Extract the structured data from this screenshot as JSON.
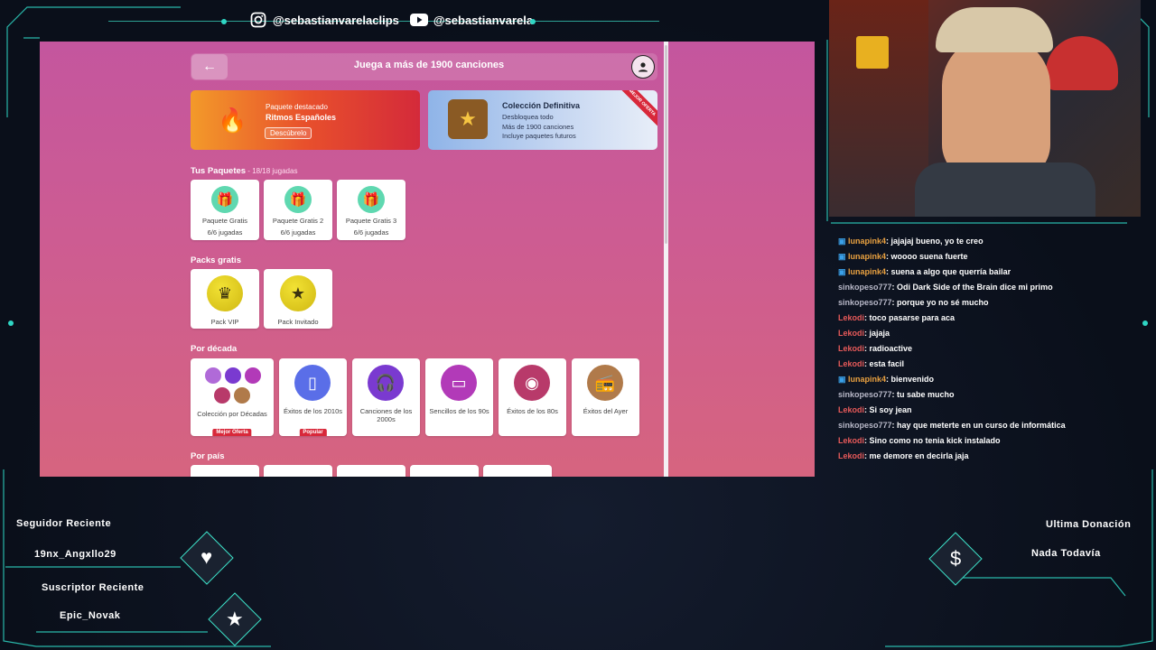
{
  "stream": {
    "instagram_handle": "@sebastianvarelaclips",
    "youtube_handle": "@sebastianvarela",
    "colors": {
      "accent": "#3de0c8",
      "frame_bg": "#0b1220"
    }
  },
  "game": {
    "title": "Juega a más de 1900 canciones",
    "banner_featured": {
      "label": "Paquete destacado",
      "name": "Ritmos Españoles",
      "button": "Descúbrelo"
    },
    "banner_collection": {
      "title": "Colección Definitiva",
      "lines": [
        "Desbloquea todo",
        "Más de 1900 canciones",
        "Incluye paquetes futuros"
      ],
      "ribbon": "MEJOR OFERTA"
    },
    "your_packs": {
      "title": "Tus Paquetes",
      "count": " - 18/18 jugadas",
      "items": [
        {
          "name": "Paquete Gratis",
          "progress": "6/6 jugadas"
        },
        {
          "name": "Paquete Gratis 2",
          "progress": "6/6 jugadas"
        },
        {
          "name": "Paquete Gratis 3",
          "progress": "6/6 jugadas"
        }
      ]
    },
    "free_packs": {
      "title": "Packs gratis",
      "items": [
        {
          "name": "Pack VIP"
        },
        {
          "name": "Pack Invitado"
        }
      ]
    },
    "by_decade": {
      "title": "Por década",
      "items": [
        {
          "name": "Colección por Décadas",
          "tag": "Mejor Oferta",
          "color": "#b06ad8"
        },
        {
          "name": "Éxitos de los 2010s",
          "tag": "Popular",
          "color": "#5a6ee8"
        },
        {
          "name": "Canciones de los 2000s",
          "tag": "",
          "color": "#7a3ad0"
        },
        {
          "name": "Sencillos de los 90s",
          "tag": "",
          "color": "#b23ab8"
        },
        {
          "name": "Éxitos de los 80s",
          "tag": "",
          "color": "#b83a6a"
        },
        {
          "name": "Éxitos del Ayer",
          "tag": "",
          "color": "#b07a4a"
        }
      ]
    },
    "by_country": {
      "title": "Por país"
    }
  },
  "chat": {
    "messages": [
      {
        "user": "lunapink4",
        "text": ": jajajaj bueno, yo te creo",
        "color": "#e8a040",
        "badge": true
      },
      {
        "user": "lunapink4",
        "text": ": woooo suena fuerte",
        "color": "#e8a040",
        "badge": true
      },
      {
        "user": "lunapink4",
        "text": ": suena a algo que querría bailar",
        "color": "#e8a040",
        "badge": true
      },
      {
        "user": "sinkopeso777",
        "text": ": Odi Dark Side of the Brain dice mi primo",
        "color": "#b8b8c8",
        "badge": false
      },
      {
        "user": "sinkopeso777",
        "text": ": porque yo no sé mucho",
        "color": "#b8b8c8",
        "badge": false
      },
      {
        "user": "Lekodi",
        "text": ": toco pasarse para aca",
        "color": "#e85a5a",
        "badge": false
      },
      {
        "user": "Lekodi",
        "text": ": jajaja",
        "color": "#e85a5a",
        "badge": false
      },
      {
        "user": "Lekodi",
        "text": ": radioactive",
        "color": "#e85a5a",
        "badge": false
      },
      {
        "user": "Lekodi",
        "text": ": esta facil",
        "color": "#e85a5a",
        "badge": false
      },
      {
        "user": "lunapink4",
        "text": ": bienvenido",
        "color": "#e8a040",
        "badge": true
      },
      {
        "user": "sinkopeso777",
        "text": ": tu sabe mucho",
        "color": "#b8b8c8",
        "badge": false
      },
      {
        "user": "Lekodi",
        "text": ": Si soy jean",
        "color": "#e85a5a",
        "badge": false
      },
      {
        "user": "sinkopeso777",
        "text": ": hay que meterte en un curso de informática",
        "color": "#b8b8c8",
        "badge": false
      },
      {
        "user": "Lekodi",
        "text": ": Sino como no tenia kick instalado",
        "color": "#e85a5a",
        "badge": false
      },
      {
        "user": "Lekodi",
        "text": ": me demore en decirla jaja",
        "color": "#e85a5a",
        "badge": false
      }
    ]
  },
  "widgets": {
    "follower_label": "Seguidor Reciente",
    "follower_name": "19nx_Angxllo29",
    "subscriber_label": "Suscriptor Reciente",
    "subscriber_name": "Epic_Novak",
    "donation_label": "Ultima Donación",
    "donation_value": "Nada Todavía"
  }
}
